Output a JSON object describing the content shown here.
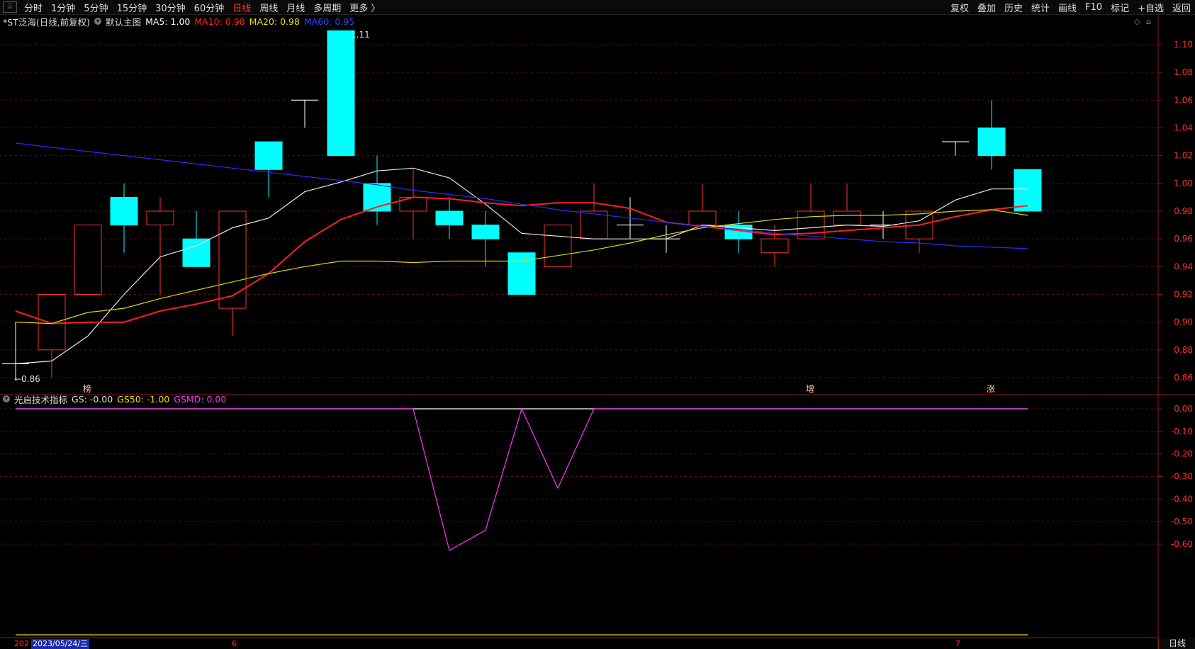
{
  "toolbar": {
    "window_icon": "⌸",
    "periods": [
      {
        "label": "分时",
        "active": false
      },
      {
        "label": "1分钟",
        "active": false
      },
      {
        "label": "5分钟",
        "active": false
      },
      {
        "label": "15分钟",
        "active": false
      },
      {
        "label": "30分钟",
        "active": false
      },
      {
        "label": "60分钟",
        "active": false
      },
      {
        "label": "日线",
        "active": true
      },
      {
        "label": "周线",
        "active": false
      },
      {
        "label": "月线",
        "active": false
      },
      {
        "label": "多周期",
        "active": false
      },
      {
        "label": "更多 〉",
        "active": false
      }
    ],
    "right_actions": [
      "复权",
      "叠加",
      "历史",
      "统计",
      "画线",
      "F10",
      "标记",
      "+自选",
      "返回"
    ]
  },
  "main_legend": {
    "stock": "*ST泛海(日线,前复权)",
    "template": "默认主图",
    "ma5": "MA5: 1.00",
    "ma10": "MA10: 0.98",
    "ma20": "MA20: 0.98",
    "ma60": "MA60: 0.95",
    "colors": {
      "ma5": "#ffffff",
      "ma10": "#ff2020",
      "ma20": "#e8e000",
      "ma60": "#2030ff"
    }
  },
  "indicator_legend": {
    "name": "光启技术指标",
    "gs": "GS: -0.00",
    "gs50": "GS50: -1.00",
    "gsmd": "GSMD: 0.00",
    "colors": {
      "gs": "#ffffff",
      "gs50": "#e8e000",
      "gsmd": "#ff33ff"
    }
  },
  "main_axis_labels": [
    "1.10",
    "1.08",
    "1.06",
    "1.04",
    "1.02",
    "1.00",
    "0.98",
    "0.96",
    "0.94",
    "0.92",
    "0.90",
    "0.88",
    "0.86"
  ],
  "indicator_axis_labels": [
    "0.00",
    "-0.10",
    "-0.20",
    "-0.30",
    "-0.40",
    "-0.50",
    "-0.60"
  ],
  "annotations": {
    "high_label": "1.11",
    "low_label": "←0.86",
    "markers": [
      {
        "text": "榜",
        "candle_index": 1
      },
      {
        "text": "增",
        "candle_index": 21
      },
      {
        "text": "涨",
        "candle_index": 26
      }
    ]
  },
  "status_bar": {
    "year": "202",
    "date": "2023/05/24/三",
    "month_6": "6",
    "month_7": "7",
    "right_cell": "日线"
  },
  "chart_data": [
    {
      "type": "candlestick",
      "title": "*ST泛海(日线,前复权)",
      "ylim": [
        0.85,
        1.12
      ],
      "candles": [
        {
          "open": 0.9,
          "high": 0.9,
          "low": 0.86,
          "close": 0.87,
          "color": "white"
        },
        {
          "open": 0.88,
          "high": 0.92,
          "low": 0.86,
          "close": 0.92,
          "color": "red"
        },
        {
          "open": 0.92,
          "high": 0.97,
          "low": 0.92,
          "close": 0.97,
          "color": "red"
        },
        {
          "open": 0.99,
          "high": 1.0,
          "low": 0.95,
          "close": 0.97,
          "color": "cyan"
        },
        {
          "open": 0.97,
          "high": 0.99,
          "low": 0.92,
          "close": 0.98,
          "color": "red"
        },
        {
          "open": 0.96,
          "high": 0.98,
          "low": 0.94,
          "close": 0.94,
          "color": "cyan"
        },
        {
          "open": 0.91,
          "high": 0.98,
          "low": 0.89,
          "close": 0.98,
          "color": "red"
        },
        {
          "open": 1.03,
          "high": 1.03,
          "low": 0.99,
          "close": 1.01,
          "color": "cyan"
        },
        {
          "open": 1.06,
          "high": 1.06,
          "low": 1.04,
          "close": 1.06,
          "color": "white"
        },
        {
          "open": 1.11,
          "high": 1.11,
          "low": 1.02,
          "close": 1.02,
          "color": "cyan"
        },
        {
          "open": 1.0,
          "high": 1.02,
          "low": 0.97,
          "close": 0.98,
          "color": "cyan"
        },
        {
          "open": 0.98,
          "high": 1.01,
          "low": 0.96,
          "close": 0.99,
          "color": "red"
        },
        {
          "open": 0.98,
          "high": 0.99,
          "low": 0.96,
          "close": 0.97,
          "color": "cyan"
        },
        {
          "open": 0.97,
          "high": 0.98,
          "low": 0.94,
          "close": 0.96,
          "color": "cyan"
        },
        {
          "open": 0.95,
          "high": 0.95,
          "low": 0.92,
          "close": 0.92,
          "color": "cyan"
        },
        {
          "open": 0.94,
          "high": 0.97,
          "low": 0.94,
          "close": 0.97,
          "color": "red"
        },
        {
          "open": 0.96,
          "high": 1.0,
          "low": 0.96,
          "close": 0.98,
          "color": "red"
        },
        {
          "open": 0.97,
          "high": 0.99,
          "low": 0.96,
          "close": 0.97,
          "color": "white"
        },
        {
          "open": 0.96,
          "high": 0.97,
          "low": 0.95,
          "close": 0.96,
          "color": "white"
        },
        {
          "open": 0.97,
          "high": 1.0,
          "low": 0.97,
          "close": 0.98,
          "color": "red"
        },
        {
          "open": 0.97,
          "high": 0.98,
          "low": 0.95,
          "close": 0.96,
          "color": "cyan"
        },
        {
          "open": 0.95,
          "high": 0.97,
          "low": 0.94,
          "close": 0.96,
          "color": "red"
        },
        {
          "open": 0.96,
          "high": 1.0,
          "low": 0.96,
          "close": 0.98,
          "color": "red"
        },
        {
          "open": 0.97,
          "high": 1.0,
          "low": 0.97,
          "close": 0.98,
          "color": "red"
        },
        {
          "open": 0.97,
          "high": 0.98,
          "low": 0.96,
          "close": 0.97,
          "color": "white"
        },
        {
          "open": 0.96,
          "high": 0.98,
          "low": 0.95,
          "close": 0.98,
          "color": "red"
        },
        {
          "open": 1.03,
          "high": 1.03,
          "low": 1.02,
          "close": 1.03,
          "color": "white"
        },
        {
          "open": 1.04,
          "high": 1.06,
          "low": 1.01,
          "close": 1.02,
          "color": "cyan"
        },
        {
          "open": 1.01,
          "high": 1.01,
          "low": 0.98,
          "close": 0.98,
          "color": "cyan"
        }
      ],
      "series": [
        {
          "name": "MA5",
          "values": [
            0.87,
            0.872,
            0.89,
            0.92,
            0.947,
            0.955,
            0.968,
            0.975,
            0.994,
            1.001,
            1.009,
            1.011,
            1.004,
            0.985,
            0.964,
            0.962,
            0.96,
            0.96,
            0.96,
            0.97,
            0.968,
            0.966,
            0.968,
            0.97,
            0.969,
            0.973,
            0.988,
            0.996,
            0.996
          ]
        },
        {
          "name": "MA10",
          "values": [
            0.908,
            0.899,
            0.9,
            0.9,
            0.908,
            0.913,
            0.919,
            0.935,
            0.958,
            0.974,
            0.983,
            0.99,
            0.989,
            0.986,
            0.984,
            0.986,
            0.986,
            0.982,
            0.972,
            0.969,
            0.966,
            0.963,
            0.964,
            0.966,
            0.968,
            0.97,
            0.976,
            0.981,
            0.984
          ]
        },
        {
          "name": "MA20",
          "values": [
            0.9,
            0.899,
            0.907,
            0.91,
            0.917,
            0.923,
            0.929,
            0.935,
            0.94,
            0.944,
            0.944,
            0.943,
            0.944,
            0.944,
            0.944,
            0.948,
            0.952,
            0.957,
            0.963,
            0.968,
            0.971,
            0.974,
            0.976,
            0.977,
            0.977,
            0.978,
            0.98,
            0.981,
            0.977
          ]
        },
        {
          "name": "MA60",
          "values": [
            1.029,
            1.026,
            1.023,
            1.02,
            1.017,
            1.014,
            1.011,
            1.008,
            1.005,
            1.002,
            0.999,
            0.995,
            0.992,
            0.989,
            0.985,
            0.981,
            0.978,
            0.975,
            0.972,
            0.969,
            0.967,
            0.964,
            0.962,
            0.96,
            0.958,
            0.957,
            0.955,
            0.954,
            0.953
          ]
        }
      ]
    },
    {
      "type": "line",
      "title": "光启技术指标",
      "ylim": [
        -0.66,
        0.0
      ],
      "series": [
        {
          "name": "GS",
          "values": [
            0,
            0,
            0,
            0,
            0,
            0,
            0,
            0,
            0,
            0,
            0,
            0,
            0,
            0,
            0,
            0,
            0,
            0,
            0,
            0,
            0,
            0,
            0,
            0,
            0,
            0,
            0,
            0,
            0
          ]
        },
        {
          "name": "GS50",
          "values": [
            -1,
            -1,
            -1,
            -1,
            -1,
            -1,
            -1,
            -1,
            -1,
            -1,
            -1,
            -1,
            -1,
            -1,
            -1,
            -1,
            -1,
            -1,
            -1,
            -1,
            -1,
            -1,
            -1,
            -1,
            -1,
            -1,
            -1,
            -1,
            -1
          ]
        },
        {
          "name": "GSMD",
          "values": [
            0,
            0,
            0,
            0,
            0,
            0,
            0,
            0,
            0,
            0,
            0,
            -0.0,
            -0.628,
            -0.538,
            0,
            -0.352,
            0,
            0,
            0,
            0,
            0,
            0,
            0,
            0,
            0,
            0,
            0,
            0,
            0
          ]
        }
      ]
    }
  ]
}
